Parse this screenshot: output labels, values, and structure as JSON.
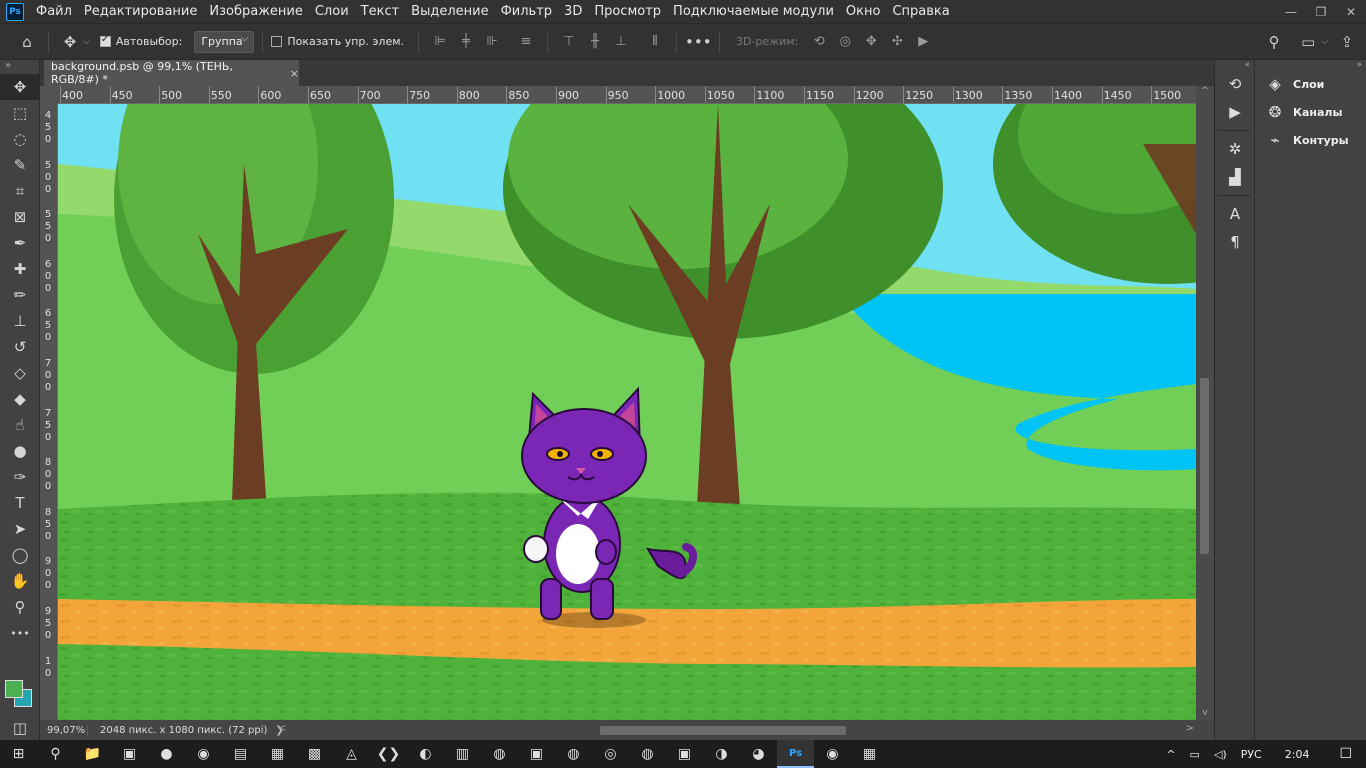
{
  "app": {
    "logo": "Ps"
  },
  "menu": [
    "Файл",
    "Редактирование",
    "Изображение",
    "Слои",
    "Текст",
    "Выделение",
    "Фильтр",
    "3D",
    "Просмотр",
    "Подключаемые модули",
    "Окно",
    "Справка"
  ],
  "window_controls": {
    "minimize": "—",
    "restore": "❐",
    "close": "✕"
  },
  "options": {
    "autoselect_label": "Автовыбор:",
    "autoselect_checked": true,
    "group_value": "Группа",
    "show_transform_label": "Показать упр. элем.",
    "show_transform_checked": false,
    "more": "•••",
    "mode3d_label": "3D-режим:"
  },
  "document": {
    "tab_title": "background.psb @ 99,1% (ТЕНЬ, RGB/8#) *",
    "close": "×"
  },
  "ruler": {
    "h_labels": [
      "400",
      "450",
      "500",
      "550",
      "600",
      "650",
      "700",
      "750",
      "800",
      "850",
      "900",
      "950",
      "1000",
      "1050",
      "1100",
      "1150",
      "1200",
      "1250",
      "1300",
      "1350",
      "1400",
      "1450",
      "1500"
    ],
    "v_labels": [
      [
        "4",
        "5",
        "0"
      ],
      [
        "5",
        "0",
        "0"
      ],
      [
        "5",
        "5",
        "0"
      ],
      [
        "6",
        "0",
        "0"
      ],
      [
        "6",
        "5",
        "0"
      ],
      [
        "7",
        "0",
        "0"
      ],
      [
        "7",
        "5",
        "0"
      ],
      [
        "8",
        "0",
        "0"
      ],
      [
        "8",
        "5",
        "0"
      ],
      [
        "9",
        "0",
        "0"
      ],
      [
        "9",
        "5",
        "0"
      ],
      [
        "1",
        "0"
      ]
    ]
  },
  "status": {
    "zoom": "99,07%",
    "doc_info": "2048 пикс. x 1080 пикс. (72 ppi)",
    "arrow": "❯"
  },
  "tools": [
    {
      "name": "move-tool",
      "glyph": "✥"
    },
    {
      "name": "marquee-tool",
      "glyph": "⬚"
    },
    {
      "name": "lasso-tool",
      "glyph": "◌"
    },
    {
      "name": "quick-select-tool",
      "glyph": "✎"
    },
    {
      "name": "crop-tool",
      "glyph": "⌗"
    },
    {
      "name": "frame-tool",
      "glyph": "⊠"
    },
    {
      "name": "eyedropper-tool",
      "glyph": "✒"
    },
    {
      "name": "healing-tool",
      "glyph": "✚"
    },
    {
      "name": "brush-tool",
      "glyph": "✏"
    },
    {
      "name": "stamp-tool",
      "glyph": "⊥"
    },
    {
      "name": "history-brush-tool",
      "glyph": "↺"
    },
    {
      "name": "eraser-tool",
      "glyph": "◇"
    },
    {
      "name": "bucket-tool",
      "glyph": "◆"
    },
    {
      "name": "smudge-tool",
      "glyph": "☝"
    },
    {
      "name": "dodge-tool",
      "glyph": "●"
    },
    {
      "name": "pen-tool",
      "glyph": "✑"
    },
    {
      "name": "type-tool",
      "glyph": "T"
    },
    {
      "name": "path-select-tool",
      "glyph": "➤"
    },
    {
      "name": "shape-tool",
      "glyph": "◯"
    },
    {
      "name": "hand-tool",
      "glyph": "✋"
    },
    {
      "name": "zoom-tool",
      "glyph": "⚲"
    },
    {
      "name": "more-tools",
      "glyph": "•••"
    }
  ],
  "colors": {
    "foreground": "#4caf50",
    "background": "#26a6b4",
    "accent": "#31a8ff"
  },
  "right_icons": [
    "history-icon",
    "actions-icon",
    "properties-icon",
    "histogram-icon",
    "character-icon",
    "paragraph-icon"
  ],
  "right_icon_glyphs": [
    "⟲",
    "▶",
    "✲",
    "▟",
    "A",
    "¶"
  ],
  "panels": [
    {
      "label": "Слои",
      "glyph": "◈"
    },
    {
      "label": "Каналы",
      "glyph": "❂"
    },
    {
      "label": "Контуры",
      "glyph": "⌁"
    }
  ],
  "taskbar": {
    "apps": [
      "⊞",
      "⚲",
      "📁",
      "▣",
      "●",
      "◉",
      "▤",
      "▦",
      "▩",
      "◬",
      "❮❯",
      "◐",
      "▥",
      "◍",
      "▣",
      "◍",
      "◎",
      "◍",
      "▣",
      "◑",
      "◕",
      "Ps",
      "◉",
      "▦"
    ],
    "tray": {
      "chevron": "^",
      "lang": "РУС",
      "time": "2:04",
      "notify": "☐"
    }
  }
}
